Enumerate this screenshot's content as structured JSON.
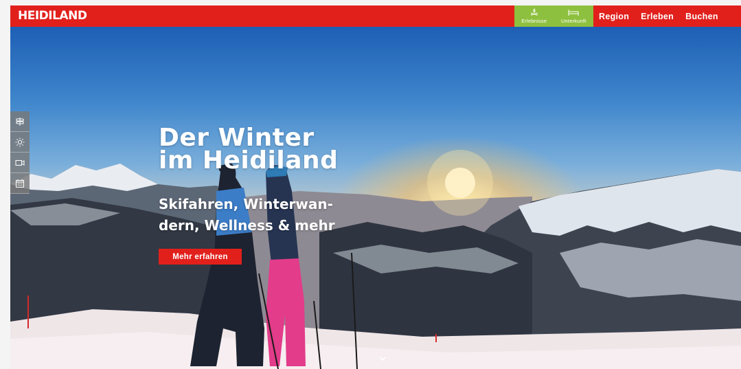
{
  "brand": {
    "logo_text": "HEIDILAND"
  },
  "quicknav": [
    {
      "label": "Erlebnisse",
      "icon": "campfire-icon"
    },
    {
      "label": "Unterkunft",
      "icon": "bed-icon"
    }
  ],
  "nav": {
    "items": [
      "Region",
      "Erleben",
      "Buchen"
    ]
  },
  "sidebar": {
    "tools": [
      "signpost-icon",
      "weather-sun-icon",
      "webcam-icon",
      "calendar-icon"
    ]
  },
  "hero": {
    "title_line1": "Der Winter",
    "title_line2": "im Heidiland",
    "subtitle_line1": "Skifahren, Winterwan-",
    "subtitle_line2": "dern, Wellness & mehr",
    "cta_label": "Mehr erfahren"
  },
  "colors": {
    "brand_red": "#e1201c",
    "accent_green": "#8ec03f"
  }
}
